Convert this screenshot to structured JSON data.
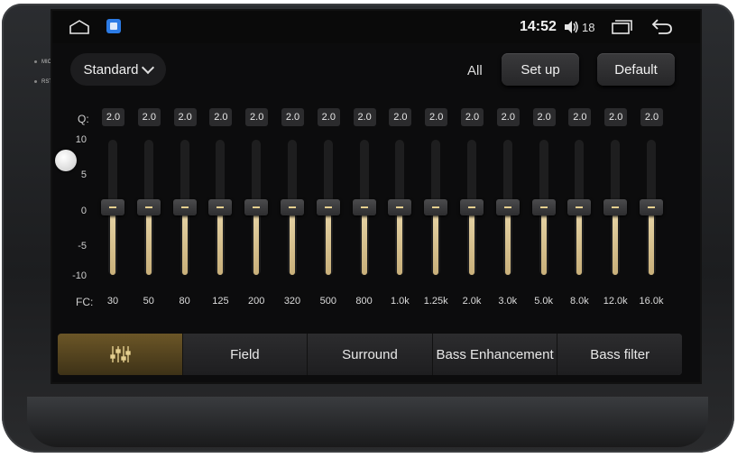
{
  "device": {
    "side_labels": [
      "MIC",
      "RST"
    ]
  },
  "statusbar": {
    "time": "14:52",
    "volume": "18"
  },
  "toolbar": {
    "preset": "Standard",
    "all_label": "All",
    "setup_label": "Set up",
    "default_label": "Default"
  },
  "eq": {
    "q_label": "Q:",
    "fc_label": "FC:",
    "scale": [
      "10",
      "5",
      "0",
      "-5",
      "-10"
    ],
    "gain_range": [
      -10,
      10
    ],
    "bands": [
      {
        "fc": "30",
        "q": "2.0",
        "gain": 0
      },
      {
        "fc": "50",
        "q": "2.0",
        "gain": 0
      },
      {
        "fc": "80",
        "q": "2.0",
        "gain": 0
      },
      {
        "fc": "125",
        "q": "2.0",
        "gain": 0
      },
      {
        "fc": "200",
        "q": "2.0",
        "gain": 0
      },
      {
        "fc": "320",
        "q": "2.0",
        "gain": 0
      },
      {
        "fc": "500",
        "q": "2.0",
        "gain": 0
      },
      {
        "fc": "800",
        "q": "2.0",
        "gain": 0
      },
      {
        "fc": "1.0k",
        "q": "2.0",
        "gain": 0
      },
      {
        "fc": "1.25k",
        "q": "2.0",
        "gain": 0
      },
      {
        "fc": "2.0k",
        "q": "2.0",
        "gain": 0
      },
      {
        "fc": "3.0k",
        "q": "2.0",
        "gain": 0
      },
      {
        "fc": "5.0k",
        "q": "2.0",
        "gain": 0
      },
      {
        "fc": "8.0k",
        "q": "2.0",
        "gain": 0
      },
      {
        "fc": "12.0k",
        "q": "2.0",
        "gain": 0
      },
      {
        "fc": "16.0k",
        "q": "2.0",
        "gain": 0
      }
    ]
  },
  "tabs": [
    {
      "label": "",
      "icon": "equalizer-icon",
      "active": true
    },
    {
      "label": "Field",
      "active": false
    },
    {
      "label": "Surround",
      "active": false
    },
    {
      "label": "Bass Enhancement",
      "active": false
    },
    {
      "label": "Bass filter",
      "active": false
    }
  ],
  "colors": {
    "accent": "#e5cf8f",
    "active_tab": "#6b5627",
    "background": "#0c0c0d"
  }
}
